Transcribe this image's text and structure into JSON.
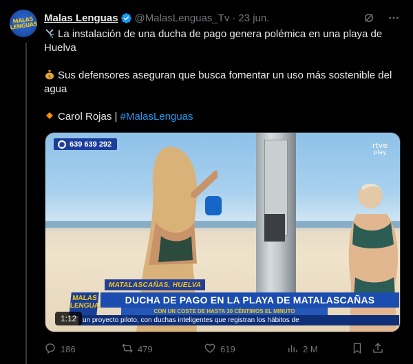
{
  "author": {
    "name": "Malas Lenguas",
    "handle": "@MalasLenguas_Tv",
    "separator": "·",
    "date": "23 jun.",
    "avatar_text": "MALAS LENGUAS"
  },
  "tweet": {
    "line1": "La instalación de una ducha de pago genera polémica en una playa de Huelva",
    "line2": "Sus defensores aseguran que busca fomentar un uso más sostenible del agua",
    "credit_prefix": "Carol Rojas |",
    "hashtag": "#MalasLenguas"
  },
  "media": {
    "phone_number": "639 639 292",
    "broadcaster_top": "rtve",
    "broadcaster_bottom": "play",
    "location": "MATALASCAÑAS, HUELVA",
    "show_logo": "MALAS LENGUAS",
    "headline": "DUCHA DE PAGO EN LA PLAYA DE MATALASCAÑAS",
    "subheadline": "CON UN COSTE DE HASTA 30 CÉNTIMOS EL MINUTO",
    "crawl": "un proyecto piloto, con duchas inteligentes que registran los hábitos de",
    "duration": "1:12"
  },
  "actions": {
    "replies": "186",
    "reposts": "479",
    "likes": "619",
    "views": "2 M"
  },
  "colors": {
    "background": "#000000",
    "text": "#e7e9ea",
    "muted": "#71767b",
    "link": "#1d9bf0",
    "verified": "#1d9bf0"
  }
}
